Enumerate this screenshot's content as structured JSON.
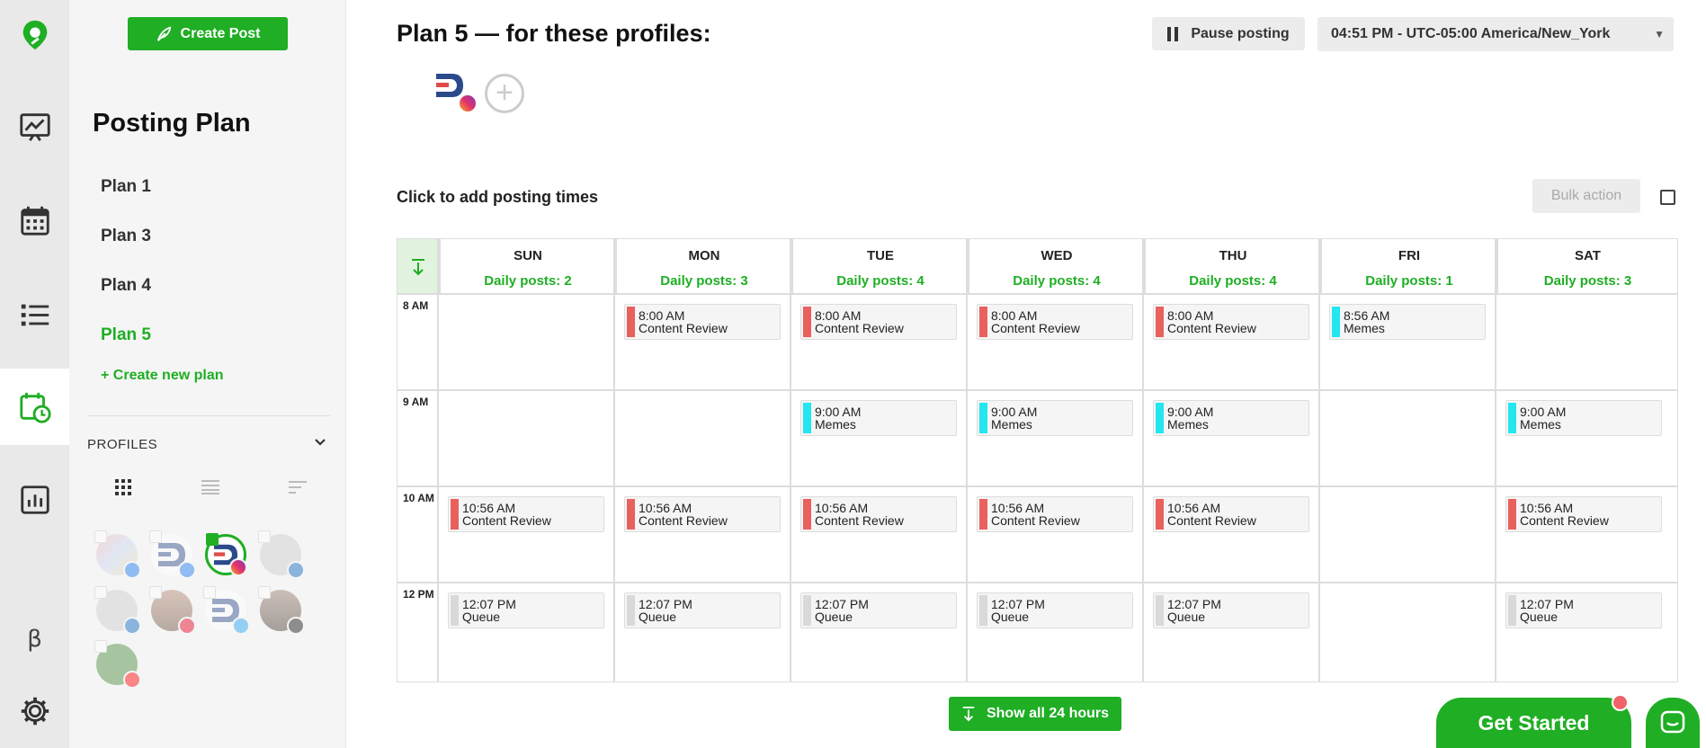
{
  "sidebar": {
    "create_post": "Create Post",
    "title": "Posting Plan",
    "plans": [
      "Plan 1",
      "Plan 3",
      "Plan 4",
      "Plan 5"
    ],
    "active_plan": "Plan 5",
    "create_plan": "+ Create new plan",
    "profiles_label": "PROFILES"
  },
  "main": {
    "title": "Plan 5 — for these profiles:",
    "pause": "Pause posting",
    "timezone": "04:51 PM - UTC-05:00 America/New_York",
    "hint": "Click to add posting times",
    "bulk": "Bulk action",
    "show_all": "Show all 24 hours",
    "get_started": "Get Started"
  },
  "colors": {
    "brand_green": "#1fae24",
    "content_review": "#e8615d",
    "memes": "#23e6ee",
    "queue": "#d9d9d9"
  },
  "calendar": {
    "days": [
      {
        "day": "SUN",
        "count": "Daily posts: 2"
      },
      {
        "day": "MON",
        "count": "Daily posts: 3"
      },
      {
        "day": "TUE",
        "count": "Daily posts: 4"
      },
      {
        "day": "WED",
        "count": "Daily posts: 4"
      },
      {
        "day": "THU",
        "count": "Daily posts: 4"
      },
      {
        "day": "FRI",
        "count": "Daily posts: 1"
      },
      {
        "day": "SAT",
        "count": "Daily posts: 3"
      }
    ],
    "hours": [
      "8 AM",
      "9 AM",
      "10 AM",
      "12 PM"
    ],
    "rows": [
      {
        "hour": "8 AM",
        "slots": [
          null,
          {
            "time": "8:00 AM",
            "label": "Content Review",
            "kind": "content_review"
          },
          {
            "time": "8:00 AM",
            "label": "Content Review",
            "kind": "content_review"
          },
          {
            "time": "8:00 AM",
            "label": "Content Review",
            "kind": "content_review"
          },
          {
            "time": "8:00 AM",
            "label": "Content Review",
            "kind": "content_review"
          },
          {
            "time": "8:56 AM",
            "label": "Memes",
            "kind": "memes"
          },
          null
        ]
      },
      {
        "hour": "9 AM",
        "slots": [
          null,
          null,
          {
            "time": "9:00 AM",
            "label": "Memes",
            "kind": "memes"
          },
          {
            "time": "9:00 AM",
            "label": "Memes",
            "kind": "memes"
          },
          {
            "time": "9:00 AM",
            "label": "Memes",
            "kind": "memes"
          },
          null,
          {
            "time": "9:00 AM",
            "label": "Memes",
            "kind": "memes"
          }
        ]
      },
      {
        "hour": "10 AM",
        "slots": [
          {
            "time": "10:56 AM",
            "label": "Content Review",
            "kind": "content_review"
          },
          {
            "time": "10:56 AM",
            "label": "Content Review",
            "kind": "content_review"
          },
          {
            "time": "10:56 AM",
            "label": "Content Review",
            "kind": "content_review"
          },
          {
            "time": "10:56 AM",
            "label": "Content Review",
            "kind": "content_review"
          },
          {
            "time": "10:56 AM",
            "label": "Content Review",
            "kind": "content_review"
          },
          null,
          {
            "time": "10:56 AM",
            "label": "Content Review",
            "kind": "content_review"
          }
        ]
      },
      {
        "hour": "12 PM",
        "slots": [
          {
            "time": "12:07 PM",
            "label": "Queue",
            "kind": "queue"
          },
          {
            "time": "12:07 PM",
            "label": "Queue",
            "kind": "queue"
          },
          {
            "time": "12:07 PM",
            "label": "Queue",
            "kind": "queue"
          },
          {
            "time": "12:07 PM",
            "label": "Queue",
            "kind": "queue"
          },
          {
            "time": "12:07 PM",
            "label": "Queue",
            "kind": "queue"
          },
          null,
          {
            "time": "12:07 PM",
            "label": "Queue",
            "kind": "queue"
          }
        ]
      }
    ]
  },
  "profiles": [
    {
      "icon": "facebook",
      "selected": false
    },
    {
      "icon": "facebook",
      "selected": false
    },
    {
      "icon": "instagram",
      "selected": true
    },
    {
      "icon": "linkedin",
      "selected": false
    },
    {
      "icon": "linkedin",
      "selected": false
    },
    {
      "icon": "pinterest",
      "selected": false
    },
    {
      "icon": "twitter",
      "selected": false
    },
    {
      "icon": "tiktok",
      "selected": false
    },
    {
      "icon": "youtube",
      "selected": false
    }
  ]
}
